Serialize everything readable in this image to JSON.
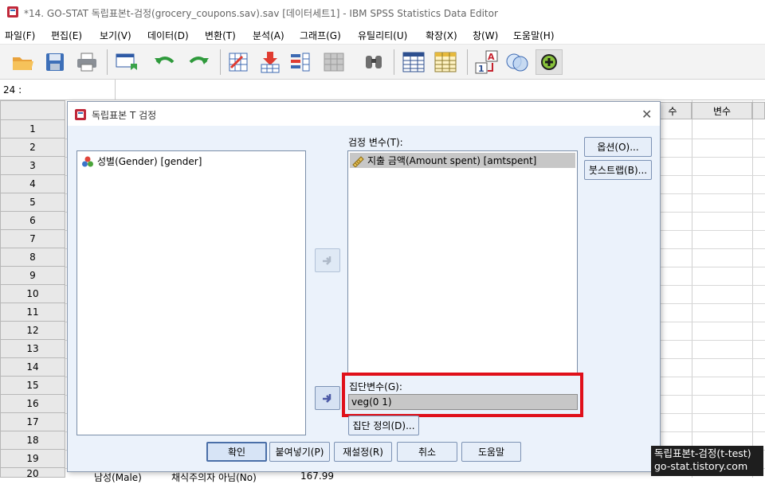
{
  "window": {
    "title": "*14. GO-STAT 독립표본t-검정(grocery_coupons.sav).sav [데이터세트1] - IBM SPSS Statistics Data Editor"
  },
  "menu": [
    {
      "label": "파일(F)"
    },
    {
      "label": "편집(E)"
    },
    {
      "label": "보기(V)"
    },
    {
      "label": "데이터(D)"
    },
    {
      "label": "변환(T)"
    },
    {
      "label": "분석(A)"
    },
    {
      "label": "그래프(G)"
    },
    {
      "label": "유틸리티(U)"
    },
    {
      "label": "확장(X)"
    },
    {
      "label": "창(W)"
    },
    {
      "label": "도움말(H)"
    }
  ],
  "toolbar": {
    "icons": [
      "open-folder-icon",
      "save-icon",
      "print-icon",
      "dialog-recall-icon",
      "undo-icon",
      "redo-icon",
      "goto-case-icon",
      "insert-cases-icon",
      "insert-variable-icon",
      "split-file-icon",
      "find-icon",
      "grid-icon",
      "select-cases-icon",
      "value-labels-icon",
      "use-sets-icon",
      "add-icon"
    ]
  },
  "cell_ref": "24 :",
  "grid": {
    "rows": [
      "1",
      "2",
      "3",
      "4",
      "5",
      "6",
      "7",
      "8",
      "9",
      "10",
      "11",
      "12",
      "13",
      "14",
      "15",
      "16",
      "17",
      "18",
      "19",
      "20"
    ],
    "visible_col_headers": [
      "수",
      "변수"
    ],
    "last_row_cells": [
      "남성(Male)",
      "채식주의자 아님(No)",
      "167.99"
    ]
  },
  "dialog": {
    "title": "독립표본 T 검정",
    "source_list": [
      {
        "label": "성별(Gender) [gender]",
        "icon": "nominal-variable-icon"
      }
    ],
    "test_vars_label": "검정 변수(T):",
    "test_vars": [
      {
        "label": "지출 금액(Amount spent) [amtspent]",
        "icon": "scale-variable-icon"
      }
    ],
    "grouping_label": "집단변수(G):",
    "grouping_value": "veg(0 1)",
    "define_groups_button": "집단 정의(D)...",
    "options_button": "옵션(O)...",
    "bootstrap_button": "붓스트랩(B)...",
    "ok_button": "확인",
    "paste_button": "붙여넣기(P)",
    "reset_button": "재설정(R)",
    "cancel_button": "취소",
    "help_button": "도움말",
    "highlight_color": "#e0101a"
  },
  "watermark": {
    "line1": "독립표본t-검정(t-test)",
    "line2": "go-stat.tistory.com"
  }
}
